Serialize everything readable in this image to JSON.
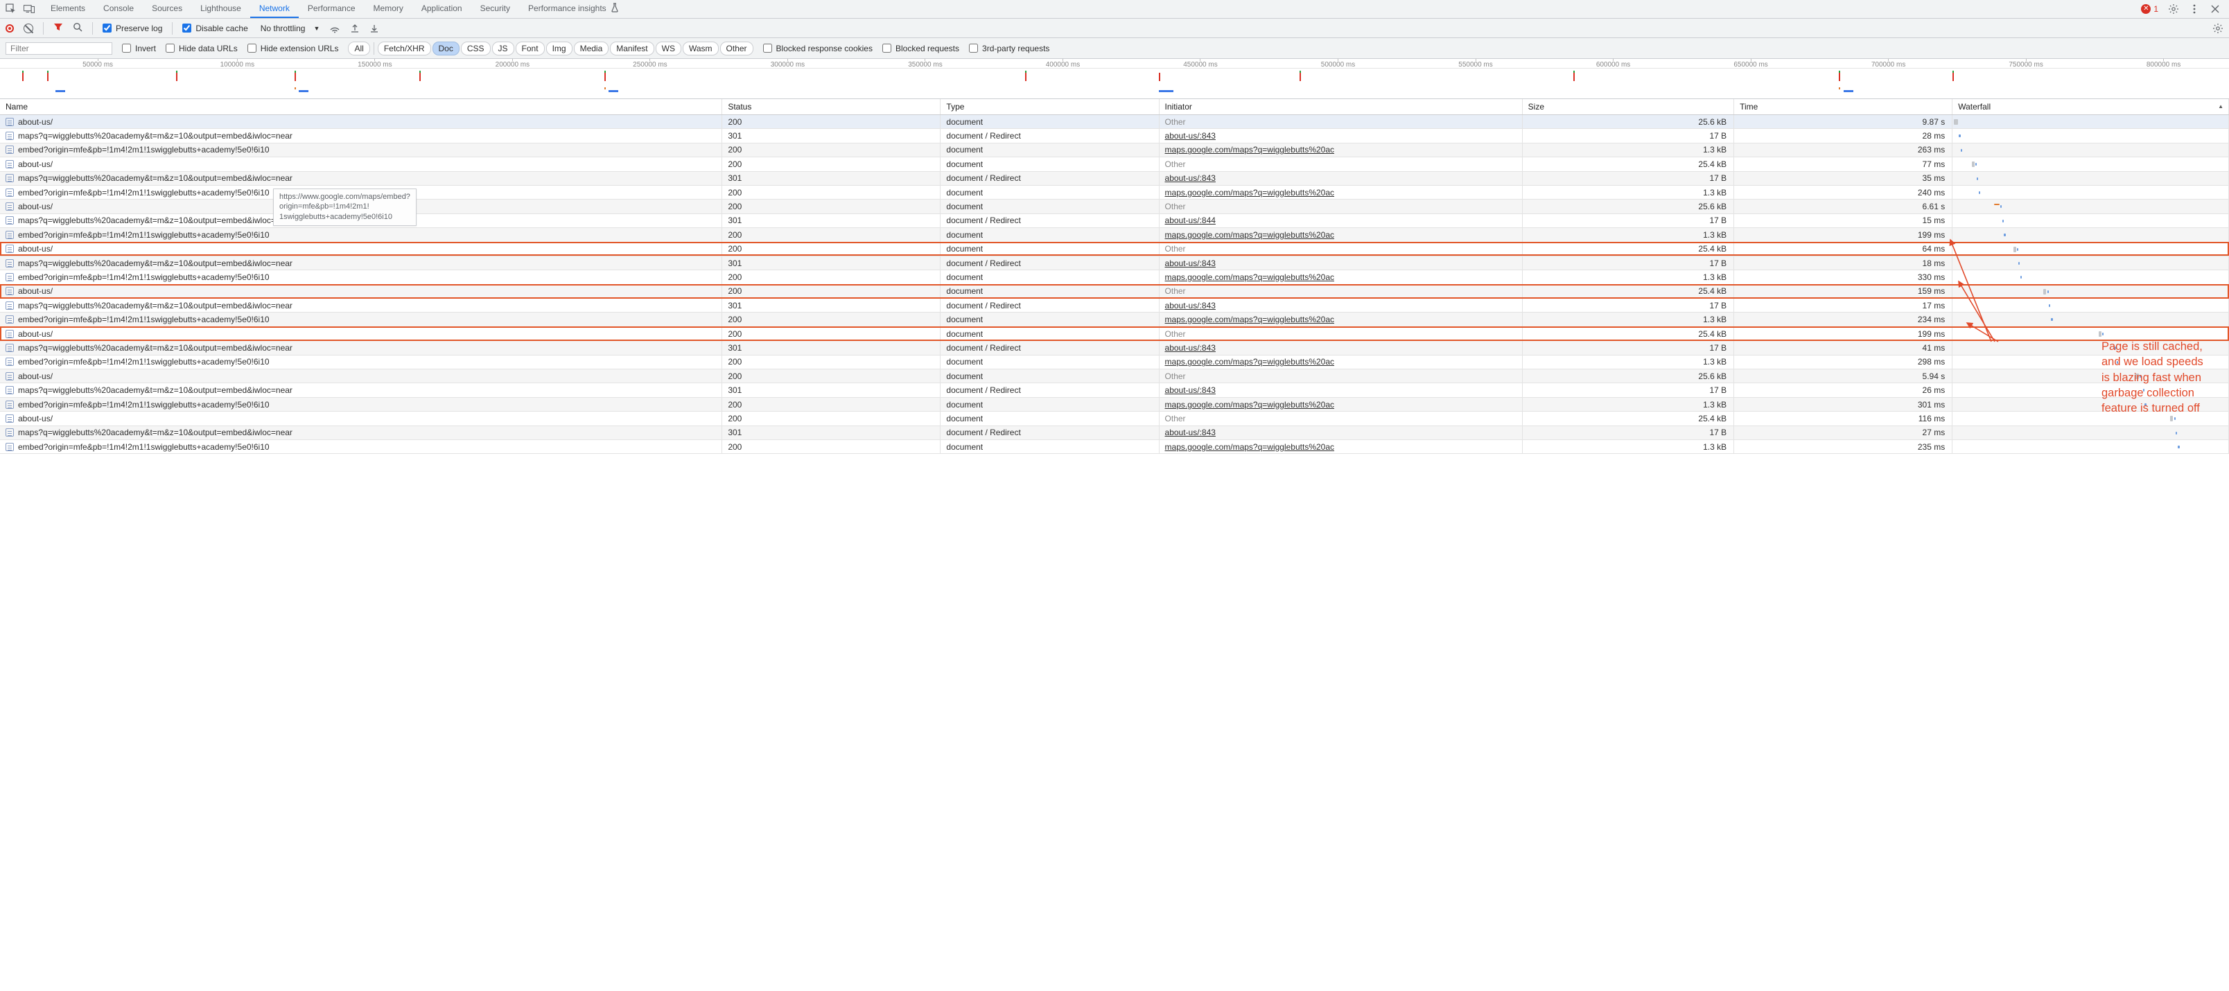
{
  "tabs": [
    "Elements",
    "Console",
    "Sources",
    "Lighthouse",
    "Network",
    "Performance",
    "Memory",
    "Application",
    "Security",
    "Performance insights"
  ],
  "active_tab": "Network",
  "errors_badge": "1",
  "toolbar2": {
    "preserve_log": "Preserve log",
    "disable_cache": "Disable cache",
    "throttling": "No throttling"
  },
  "filterbar": {
    "filter_placeholder": "Filter",
    "invert": "Invert",
    "hide_data_urls": "Hide data URLs",
    "hide_ext_urls": "Hide extension URLs",
    "pills": [
      "All",
      "Fetch/XHR",
      "Doc",
      "CSS",
      "JS",
      "Font",
      "Img",
      "Media",
      "Manifest",
      "WS",
      "Wasm",
      "Other"
    ],
    "pill_active": "Doc",
    "blocked_cookies": "Blocked response cookies",
    "blocked_requests": "Blocked requests",
    "third_party": "3rd-party requests"
  },
  "overview_ticks": [
    "50000 ms",
    "100000 ms",
    "150000 ms",
    "200000 ms",
    "250000 ms",
    "300000 ms",
    "350000 ms",
    "400000 ms",
    "450000 ms",
    "500000 ms",
    "550000 ms",
    "600000 ms",
    "650000 ms",
    "700000 ms",
    "750000 ms",
    "800000 ms"
  ],
  "headers": {
    "name": "Name",
    "status": "Status",
    "type": "Type",
    "initiator": "Initiator",
    "size": "Size",
    "time": "Time",
    "waterfall": "Waterfall"
  },
  "tooltip": "https://www.google.com/maps/embed?\norigin=mfe&pb=!1m4!2m1!\n1swigglebutts+academy!5e0!6i10",
  "annotation": "Page is still cached,\nand we load speeds\nis blazing fast when\ngarbage collection\nfeature is turned off",
  "rows": [
    {
      "name": "about-us/",
      "status": "200",
      "type": "document",
      "init": "Other",
      "init_link": false,
      "size": "25.6 kB",
      "time": "9.87 s",
      "sel": true,
      "hl": false,
      "wf": [
        {
          "c": "grey",
          "l": 0.5,
          "w": 1.5
        }
      ]
    },
    {
      "name": "maps?q=wigglebutts%20academy&t=m&z=10&output=embed&iwloc=near",
      "status": "301",
      "type": "document / Redirect",
      "init": "about-us/:843",
      "init_link": true,
      "size": "17 B",
      "time": "28 ms",
      "wf": [
        {
          "c": "blue",
          "l": 2.3,
          "w": 0.6
        }
      ]
    },
    {
      "name": "embed?origin=mfe&pb=!1m4!2m1!1swigglebutts+academy!5e0!6i10",
      "status": "200",
      "type": "document",
      "init": "maps.google.com/maps?q=wigglebutts%20ac",
      "init_link": true,
      "size": "1.3 kB",
      "time": "263 ms",
      "wf": [
        {
          "c": "blue",
          "l": 2.9,
          "w": 0.6
        }
      ]
    },
    {
      "name": "about-us/",
      "status": "200",
      "type": "document",
      "init": "Other",
      "init_link": false,
      "size": "25.4 kB",
      "time": "77 ms",
      "wf": [
        {
          "c": "grey",
          "l": 7,
          "w": 1
        },
        {
          "c": "blue",
          "l": 8.2,
          "w": 0.5
        }
      ]
    },
    {
      "name": "maps?q=wigglebutts%20academy&t=m&z=10&output=embed&iwloc=near",
      "status": "301",
      "type": "document / Redirect",
      "init": "about-us/:843",
      "init_link": true,
      "size": "17 B",
      "time": "35 ms",
      "wf": [
        {
          "c": "blue",
          "l": 8.8,
          "w": 0.5
        }
      ]
    },
    {
      "name": "embed?origin=mfe&pb=!1m4!2m1!1swigglebutts+academy!5e0!6i10",
      "status": "200",
      "type": "document",
      "init": "maps.google.com/maps?q=wigglebutts%20ac",
      "init_link": true,
      "size": "1.3 kB",
      "time": "240 ms",
      "wf": [
        {
          "c": "blue",
          "l": 9.4,
          "w": 0.6
        }
      ]
    },
    {
      "name": "about-us/",
      "status": "200",
      "type": "document",
      "init": "Other",
      "init_link": false,
      "size": "25.6 kB",
      "time": "6.61 s",
      "wf": [
        {
          "c": "orange",
          "l": 15,
          "w": 2
        },
        {
          "c": "blue",
          "l": 17.2,
          "w": 0.6
        }
      ]
    },
    {
      "name": "maps?q=wigglebutts%20academy&t=m&z=10&output=embed&iwloc=near",
      "status": "301",
      "type": "document / Redirect",
      "init": "about-us/:844",
      "init_link": true,
      "size": "17 B",
      "time": "15 ms",
      "wf": [
        {
          "c": "blue",
          "l": 18,
          "w": 0.5
        }
      ]
    },
    {
      "name": "embed?origin=mfe&pb=!1m4!2m1!1swigglebutts+academy!5e0!6i10",
      "status": "200",
      "type": "document",
      "init": "maps.google.com/maps?q=wigglebutts%20ac",
      "init_link": true,
      "size": "1.3 kB",
      "time": "199 ms",
      "wf": [
        {
          "c": "blue",
          "l": 18.6,
          "w": 0.6
        }
      ]
    },
    {
      "name": "about-us/",
      "status": "200",
      "type": "document",
      "init": "Other",
      "init_link": false,
      "size": "25.4 kB",
      "time": "64 ms",
      "hl": true,
      "wf": [
        {
          "c": "grey",
          "l": 22,
          "w": 1
        },
        {
          "c": "blue",
          "l": 23.3,
          "w": 0.5
        }
      ]
    },
    {
      "name": "maps?q=wigglebutts%20academy&t=m&z=10&output=embed&iwloc=near",
      "status": "301",
      "type": "document / Redirect",
      "init": "about-us/:843",
      "init_link": true,
      "size": "17 B",
      "time": "18 ms",
      "wf": [
        {
          "c": "blue",
          "l": 23.9,
          "w": 0.5
        }
      ]
    },
    {
      "name": "embed?origin=mfe&pb=!1m4!2m1!1swigglebutts+academy!5e0!6i10",
      "status": "200",
      "type": "document",
      "init": "maps.google.com/maps?q=wigglebutts%20ac",
      "init_link": true,
      "size": "1.3 kB",
      "time": "330 ms",
      "wf": [
        {
          "c": "blue",
          "l": 24.5,
          "w": 0.6
        }
      ]
    },
    {
      "name": "about-us/",
      "status": "200",
      "type": "document",
      "init": "Other",
      "init_link": false,
      "size": "25.4 kB",
      "time": "159 ms",
      "hl": true,
      "wf": [
        {
          "c": "grey",
          "l": 33,
          "w": 1
        },
        {
          "c": "blue",
          "l": 34.3,
          "w": 0.5
        }
      ]
    },
    {
      "name": "maps?q=wigglebutts%20academy&t=m&z=10&output=embed&iwloc=near",
      "status": "301",
      "type": "document / Redirect",
      "init": "about-us/:843",
      "init_link": true,
      "size": "17 B",
      "time": "17 ms",
      "wf": [
        {
          "c": "blue",
          "l": 35,
          "w": 0.5
        }
      ]
    },
    {
      "name": "embed?origin=mfe&pb=!1m4!2m1!1swigglebutts+academy!5e0!6i10",
      "status": "200",
      "type": "document",
      "init": "maps.google.com/maps?q=wigglebutts%20ac",
      "init_link": true,
      "size": "1.3 kB",
      "time": "234 ms",
      "wf": [
        {
          "c": "blue",
          "l": 35.7,
          "w": 0.6
        }
      ]
    },
    {
      "name": "about-us/",
      "status": "200",
      "type": "document",
      "init": "Other",
      "init_link": false,
      "size": "25.4 kB",
      "time": "199 ms",
      "hl": true,
      "wf": [
        {
          "c": "grey",
          "l": 53,
          "w": 1
        },
        {
          "c": "blue",
          "l": 54.3,
          "w": 0.5
        }
      ]
    },
    {
      "name": "maps?q=wigglebutts%20academy&t=m&z=10&output=embed&iwloc=near",
      "status": "301",
      "type": "document / Redirect",
      "init": "about-us/:843",
      "init_link": true,
      "size": "17 B",
      "time": "41 ms",
      "wf": [
        {
          "c": "blue",
          "l": 58.8,
          "w": 0.6
        }
      ]
    },
    {
      "name": "embed?origin=mfe&pb=!1m4!2m1!1swigglebutts+academy!5e0!6i10",
      "status": "200",
      "type": "document",
      "init": "maps.google.com/maps?q=wigglebutts%20ac",
      "init_link": true,
      "size": "1.3 kB",
      "time": "298 ms",
      "wf": [
        {
          "c": "blue",
          "l": 59.5,
          "w": 0.6
        }
      ]
    },
    {
      "name": "about-us/",
      "status": "200",
      "type": "document",
      "init": "Other",
      "init_link": false,
      "size": "25.6 kB",
      "time": "5.94 s",
      "wf": [
        {
          "c": "grey",
          "l": 66,
          "w": 1.5
        },
        {
          "c": "blue",
          "l": 67.8,
          "w": 0.6
        }
      ]
    },
    {
      "name": "maps?q=wigglebutts%20academy&t=m&z=10&output=embed&iwloc=near",
      "status": "301",
      "type": "document / Redirect",
      "init": "about-us/:843",
      "init_link": true,
      "size": "17 B",
      "time": "26 ms",
      "wf": [
        {
          "c": "blue",
          "l": 69,
          "w": 0.5
        }
      ]
    },
    {
      "name": "embed?origin=mfe&pb=!1m4!2m1!1swigglebutts+academy!5e0!6i10",
      "status": "200",
      "type": "document",
      "init": "maps.google.com/maps?q=wigglebutts%20ac",
      "init_link": true,
      "size": "1.3 kB",
      "time": "301 ms",
      "wf": [
        {
          "c": "blue",
          "l": 69.7,
          "w": 0.6
        }
      ]
    },
    {
      "name": "about-us/",
      "status": "200",
      "type": "document",
      "init": "Other",
      "init_link": false,
      "size": "25.4 kB",
      "time": "116 ms",
      "wf": [
        {
          "c": "grey",
          "l": 79,
          "w": 1
        },
        {
          "c": "blue",
          "l": 80.3,
          "w": 0.5
        }
      ]
    },
    {
      "name": "maps?q=wigglebutts%20academy&t=m&z=10&output=embed&iwloc=near",
      "status": "301",
      "type": "document / Redirect",
      "init": "about-us/:843",
      "init_link": true,
      "size": "17 B",
      "time": "27 ms",
      "wf": [
        {
          "c": "blue",
          "l": 81,
          "w": 0.5
        }
      ]
    },
    {
      "name": "embed?origin=mfe&pb=!1m4!2m1!1swigglebutts+academy!5e0!6i10",
      "status": "200",
      "type": "document",
      "init": "maps.google.com/maps?q=wigglebutts%20ac",
      "init_link": true,
      "size": "1.3 kB",
      "time": "235 ms",
      "wf": [
        {
          "c": "blue",
          "l": 81.7,
          "w": 0.6
        }
      ]
    }
  ]
}
